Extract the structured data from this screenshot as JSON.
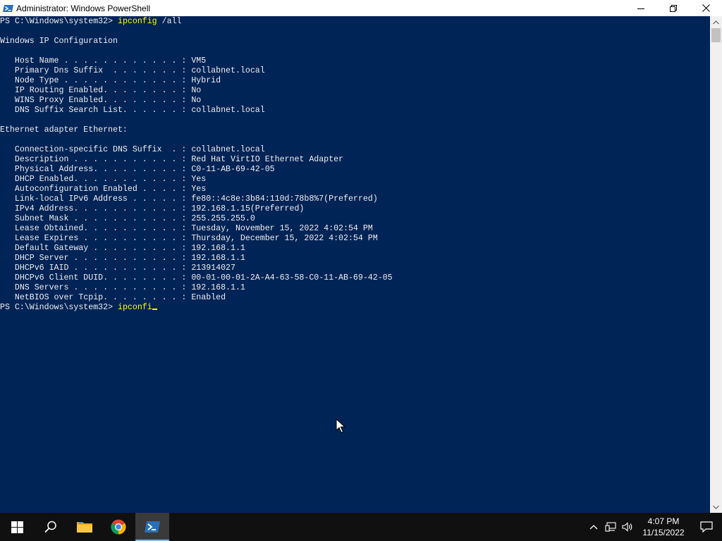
{
  "window": {
    "title": "Administrator: Windows PowerShell",
    "background_color": "#012456",
    "text_color": "#eeedf0",
    "command_color": "#ffff00"
  },
  "console": {
    "lines": [
      {
        "kind": "prompt",
        "prompt": "PS C:\\Windows\\system32> ",
        "command": "ipconfig",
        "args": " /all"
      },
      {
        "kind": "text",
        "text": ""
      },
      {
        "kind": "text",
        "text": "Windows IP Configuration"
      },
      {
        "kind": "text",
        "text": ""
      },
      {
        "kind": "text",
        "text": "   Host Name . . . . . . . . . . . . : VM5"
      },
      {
        "kind": "text",
        "text": "   Primary Dns Suffix  . . . . . . . : collabnet.local"
      },
      {
        "kind": "text",
        "text": "   Node Type . . . . . . . . . . . . : Hybrid"
      },
      {
        "kind": "text",
        "text": "   IP Routing Enabled. . . . . . . . : No"
      },
      {
        "kind": "text",
        "text": "   WINS Proxy Enabled. . . . . . . . : No"
      },
      {
        "kind": "text",
        "text": "   DNS Suffix Search List. . . . . . : collabnet.local"
      },
      {
        "kind": "text",
        "text": ""
      },
      {
        "kind": "text",
        "text": "Ethernet adapter Ethernet:"
      },
      {
        "kind": "text",
        "text": ""
      },
      {
        "kind": "text",
        "text": "   Connection-specific DNS Suffix  . : collabnet.local"
      },
      {
        "kind": "text",
        "text": "   Description . . . . . . . . . . . : Red Hat VirtIO Ethernet Adapter"
      },
      {
        "kind": "text",
        "text": "   Physical Address. . . . . . . . . : C0-11-AB-69-42-05"
      },
      {
        "kind": "text",
        "text": "   DHCP Enabled. . . . . . . . . . . : Yes"
      },
      {
        "kind": "text",
        "text": "   Autoconfiguration Enabled . . . . : Yes"
      },
      {
        "kind": "text",
        "text": "   Link-local IPv6 Address . . . . . : fe80::4c8e:3b84:110d:78b8%7(Preferred)"
      },
      {
        "kind": "text",
        "text": "   IPv4 Address. . . . . . . . . . . : 192.168.1.15(Preferred)"
      },
      {
        "kind": "text",
        "text": "   Subnet Mask . . . . . . . . . . . : 255.255.255.0"
      },
      {
        "kind": "text",
        "text": "   Lease Obtained. . . . . . . . . . : Tuesday, November 15, 2022 4:02:54 PM"
      },
      {
        "kind": "text",
        "text": "   Lease Expires . . . . . . . . . . : Thursday, December 15, 2022 4:02:54 PM"
      },
      {
        "kind": "text",
        "text": "   Default Gateway . . . . . . . . . : 192.168.1.1"
      },
      {
        "kind": "text",
        "text": "   DHCP Server . . . . . . . . . . . : 192.168.1.1"
      },
      {
        "kind": "text",
        "text": "   DHCPv6 IAID . . . . . . . . . . . : 213914027"
      },
      {
        "kind": "text",
        "text": "   DHCPv6 Client DUID. . . . . . . . : 00-01-00-01-2A-A4-63-58-C0-11-AB-69-42-05"
      },
      {
        "kind": "text",
        "text": "   DNS Servers . . . . . . . . . . . : 192.168.1.1"
      },
      {
        "kind": "text",
        "text": "   NetBIOS over Tcpip. . . . . . . . : Enabled"
      },
      {
        "kind": "input",
        "prompt": "PS C:\\Windows\\system32> ",
        "command": "ipconfi",
        "args": ""
      }
    ]
  },
  "taskbar": {
    "items": [
      {
        "name": "start-button",
        "icon": "windows-logo-icon"
      },
      {
        "name": "search-button",
        "icon": "search-icon"
      },
      {
        "name": "file-explorer-button",
        "icon": "folder-icon"
      },
      {
        "name": "chrome-button",
        "icon": "chrome-icon"
      },
      {
        "name": "powershell-button",
        "icon": "powershell-icon",
        "active": true
      }
    ],
    "tray": {
      "time": "4:07 PM",
      "date": "11/15/2022"
    },
    "background_color": "#101010",
    "accent_color": "#76b9ed"
  }
}
